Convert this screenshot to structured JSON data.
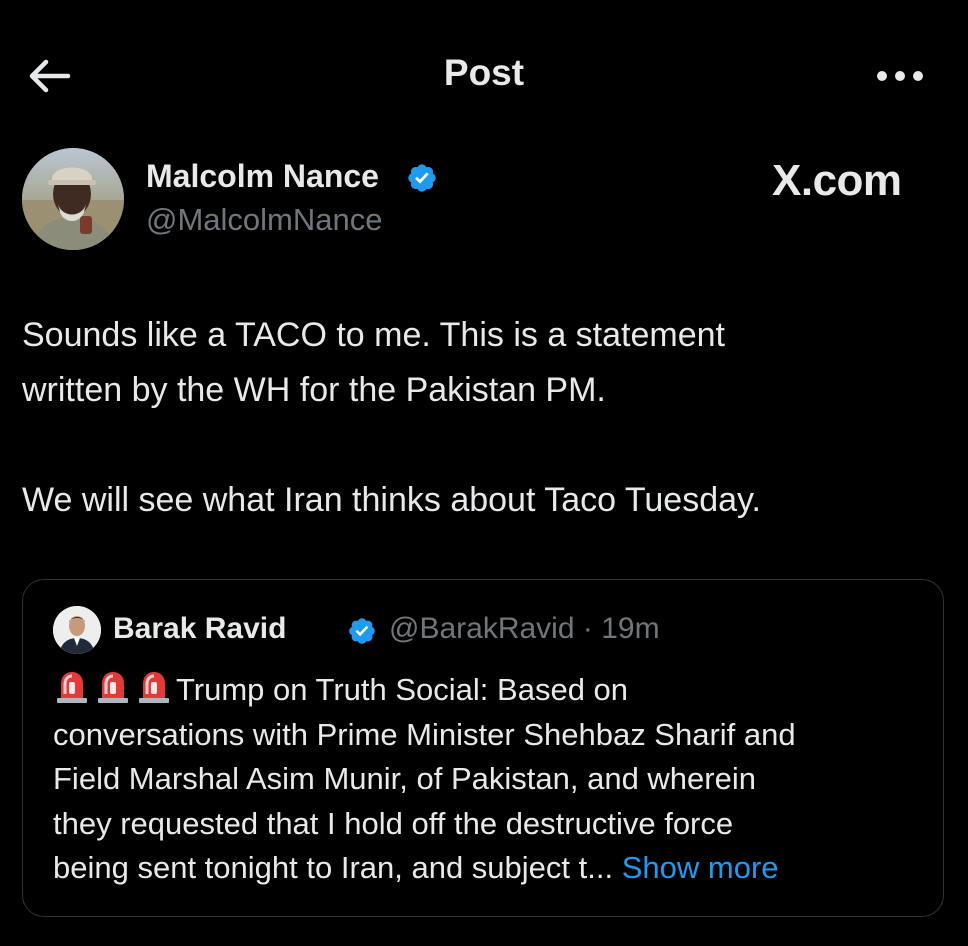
{
  "header": {
    "title": "Post"
  },
  "author": {
    "name": "Malcolm Nance",
    "handle": "@MalcolmNance"
  },
  "watermark": "X.com",
  "post": {
    "lines": [
      "Sounds like a TACO to me.  This is a statement",
      "written by the WH for the Pakistan PM.",
      "We will see what Iran thinks about Taco Tuesday."
    ]
  },
  "quoted": {
    "name": "Barak Ravid",
    "handle": "@BarakRavid",
    "separator": "·",
    "time": "19m",
    "lines": [
      "Trump on Truth Social: Based on",
      "conversations with Prime Minister Shehbaz Sharif and",
      "Field Marshal Asim Munir, of Pakistan, and wherein",
      "they requested that I hold off the destructive force",
      "being sent tonight to Iran, and subject t..."
    ],
    "show_more": "Show more"
  },
  "icons": {
    "back": "back-arrow-icon",
    "more": "more-dots-icon",
    "verified": "verified-badge-icon",
    "siren": "police-siren-emoji"
  },
  "colors": {
    "background": "#000000",
    "text": "#e7e9ea",
    "secondary": "#71767b",
    "link": "#1d9bf0",
    "verified": "#1d9bf0",
    "border": "#2f3336"
  }
}
